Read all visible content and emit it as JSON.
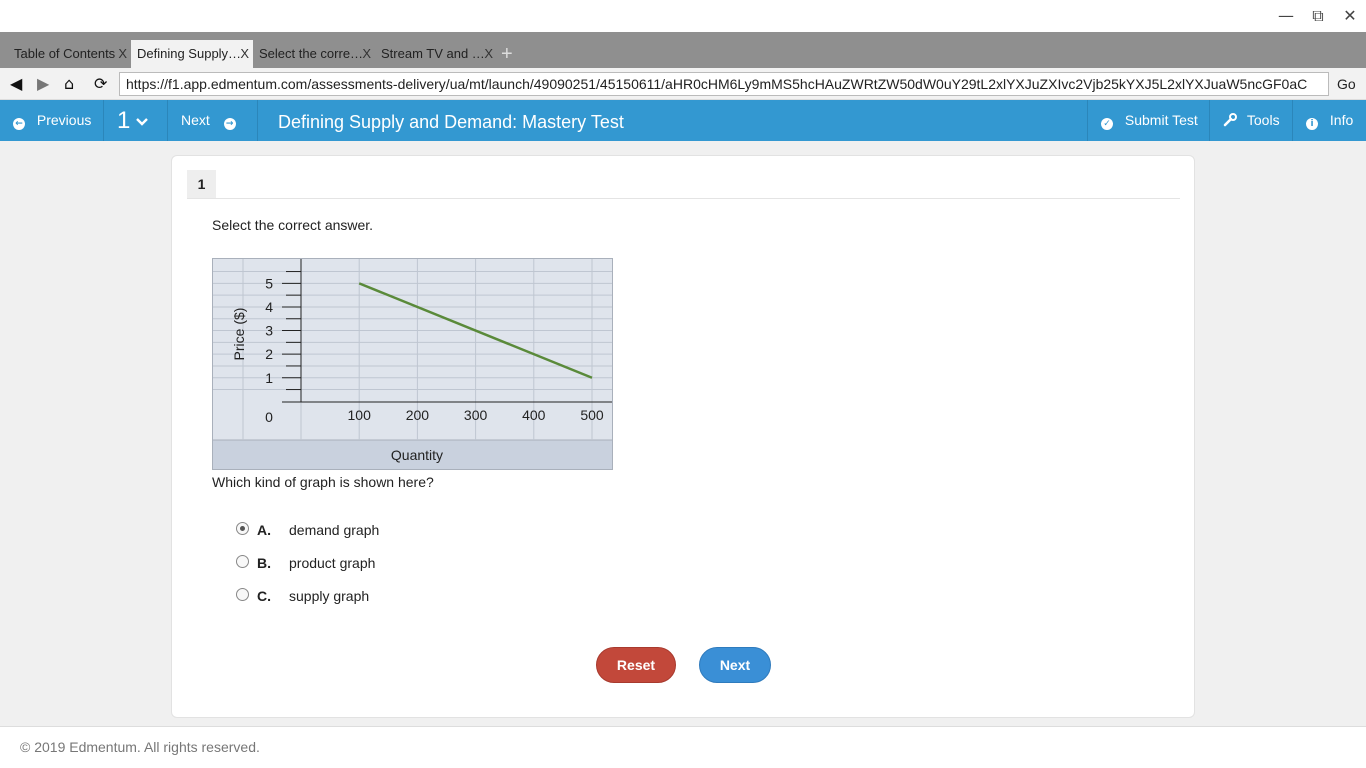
{
  "window": {
    "minimize": "—",
    "restore": "⧉",
    "close": "✕"
  },
  "tabs": [
    {
      "label": "Table of Contents",
      "close": "X",
      "active": false
    },
    {
      "label": "Defining Supply…",
      "close": "X",
      "active": true
    },
    {
      "label": "Select the corre…",
      "close": "X",
      "active": false
    },
    {
      "label": "Stream TV and …",
      "close": "X",
      "active": false
    }
  ],
  "new_tab": "+",
  "address": {
    "back": "◀",
    "forward": "▶",
    "home": "⌂",
    "reload": "⟳",
    "url": "https://f1.app.edmentum.com/assessments-delivery/ua/mt/launch/49090251/45150611/aHR0cHM6Ly9mMS5hcHAuZWRtZW50dW0uY29tL2xlYXJuZXIvc2Vjb25kYXJ5L2xlYXJuaW5ncGF0aC",
    "go": "Go"
  },
  "header": {
    "previous_label": "Previous",
    "question_selector": "1",
    "next_label": "Next",
    "title": "Defining Supply and Demand: Mastery Test",
    "submit_label": "Submit Test",
    "tools_label": "Tools",
    "info_label": "Info",
    "accent_color": "#3398d1"
  },
  "question": {
    "number": "1",
    "prompt": "Select the correct answer.",
    "text": "Which kind of graph is shown here?",
    "options": [
      {
        "letter": "A.",
        "text": "demand graph",
        "selected": true
      },
      {
        "letter": "B.",
        "text": "product graph",
        "selected": false
      },
      {
        "letter": "C.",
        "text": "supply graph",
        "selected": false
      }
    ]
  },
  "buttons": {
    "reset": "Reset",
    "next": "Next"
  },
  "chart_data": {
    "type": "line",
    "title": "",
    "xlabel": "Quantity",
    "ylabel": "Price ($)",
    "x_ticks": [
      "100",
      "200",
      "300",
      "400",
      "500"
    ],
    "y_ticks": [
      "1",
      "2",
      "3",
      "4",
      "5"
    ],
    "origin_label": "0",
    "xlim": [
      0,
      500
    ],
    "ylim": [
      0,
      5
    ],
    "grid": true,
    "series": [
      {
        "x": [
          100,
          500
        ],
        "y": [
          5,
          1
        ],
        "color": "#5a8a3a"
      }
    ]
  },
  "footer": {
    "copyright": "© 2019 Edmentum. All rights reserved."
  }
}
